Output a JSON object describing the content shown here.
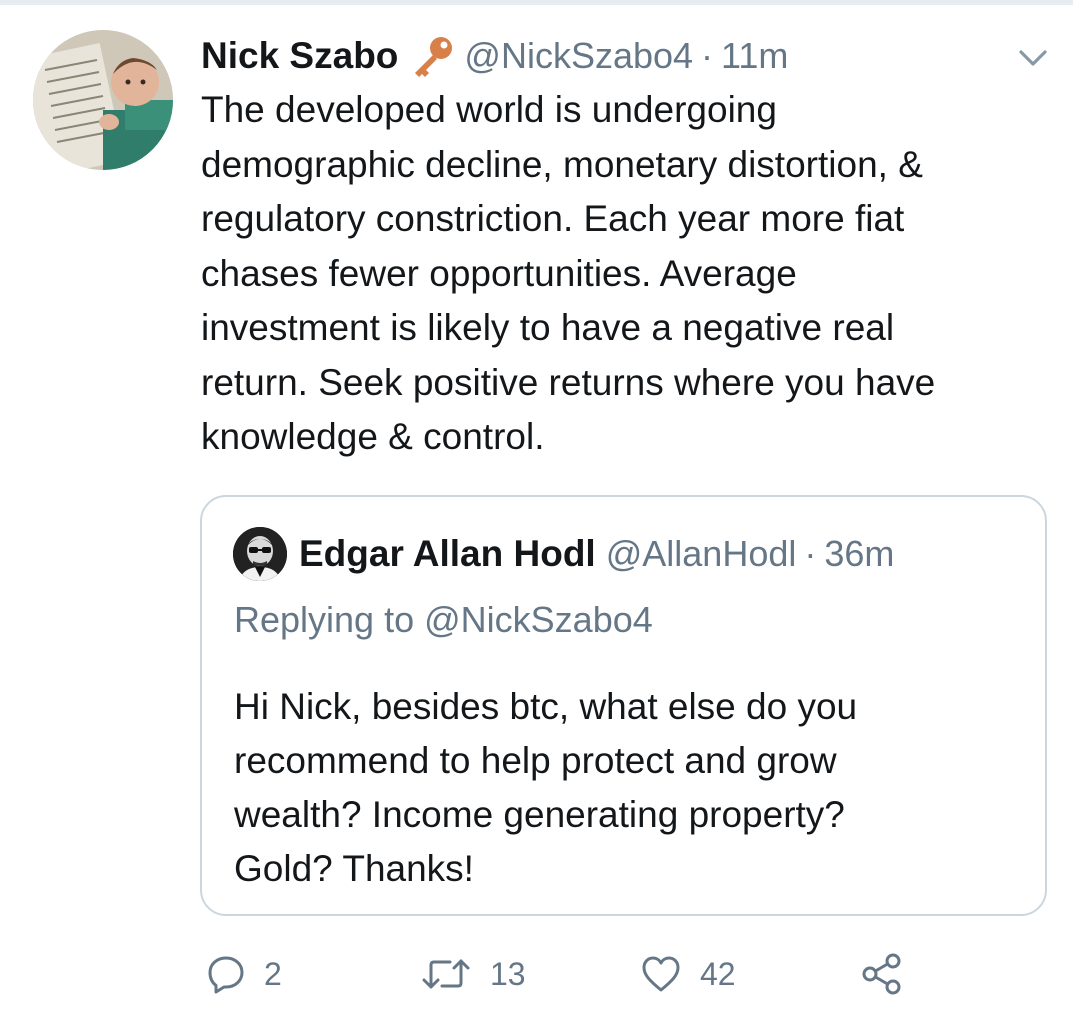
{
  "tweet": {
    "author_name": "Nick Szabo",
    "author_badge_icon": "key-icon",
    "author_handle": "@NickSzabo4",
    "time_separator": "·",
    "time_ago": "11m",
    "text": "The developed world is undergoing\ndemographic decline, monetary distortion, &\nregulatory constriction. Each year more fiat\nchases fewer opportunities. Average\ninvestment is likely to have a negative real\nreturn. Seek positive returns where you have\nknowledge & control."
  },
  "quote": {
    "author_name": "Edgar Allan Hodl",
    "author_handle": "@AllanHodl",
    "time_separator": "·",
    "time_ago": "36m",
    "replying_prefix": "Replying to",
    "replying_to": "@NickSzabo4",
    "text": "Hi Nick, besides btc, what else do you\nrecommend to help protect and grow\nwealth?  Income generating property?\nGold?  Thanks!"
  },
  "actions": {
    "reply_count": "2",
    "retweet_count": "13",
    "like_count": "42"
  },
  "colors": {
    "text": "#14171a",
    "secondary_text": "#657786",
    "border": "#ccd6dd",
    "key_icon": "#d8804a"
  }
}
